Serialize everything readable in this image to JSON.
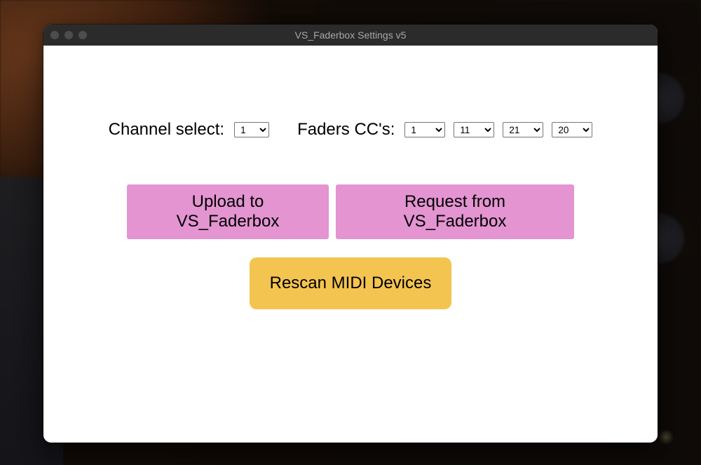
{
  "window": {
    "title": "VS_Faderbox Settings v5"
  },
  "labels": {
    "channel_select": "Channel select:",
    "faders_cc": "Faders CC's:"
  },
  "selects": {
    "channel": "1",
    "cc": [
      "1",
      "11",
      "21",
      "20"
    ]
  },
  "buttons": {
    "upload": "Upload to VS_Faderbox",
    "request": "Request from VS_Faderbox",
    "rescan": "Rescan MIDI Devices"
  }
}
